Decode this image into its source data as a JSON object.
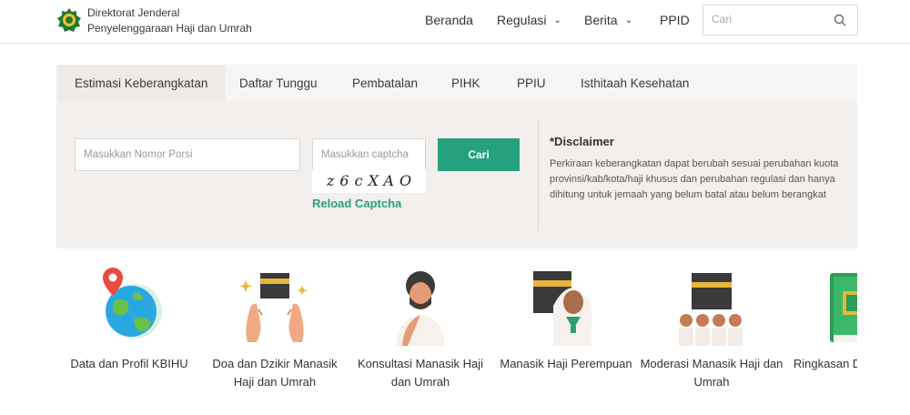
{
  "header": {
    "brand_line1": "Direktorat Jenderal",
    "brand_line2": "Penyelenggaraan Haji dan Umrah",
    "nav": [
      "Beranda",
      "Regulasi",
      "Berita",
      "PPID"
    ],
    "search_placeholder": "Cari"
  },
  "tabs": [
    "Estimasi Keberangkatan",
    "Daftar Tunggu",
    "Pembatalan",
    "PIHK",
    "PPIU",
    "Isthitaah Kesehatan"
  ],
  "form": {
    "porsi_placeholder": "Masukkan Nomor Porsi",
    "captcha_placeholder": "Masukkan captcha",
    "captcha_text": "z6cXAO",
    "submit_label": "Cari",
    "reload_label": "Reload Captcha"
  },
  "disclaimer": {
    "title": "*Disclaimer",
    "text": "Perkiraan keberangkatan dapat berubah sesuai perubahan kuota provinsi/kab/kota/haji khusus dan perubahan regulasi dan hanya dihitung untuk jemaah yang belum batal atau belum berangkat"
  },
  "services": [
    {
      "label": "Data dan Profil KBIHU",
      "icon": "globe-pin-icon"
    },
    {
      "label": "Doa dan Dzikir Manasik Haji dan Umrah",
      "icon": "praying-hands-icon"
    },
    {
      "label": "Konsultasi Manasik Haji dan Umrah",
      "icon": "pilgrim-man-icon"
    },
    {
      "label": "Manasik Haji Perempuan",
      "icon": "pilgrim-woman-icon"
    },
    {
      "label": "Moderasi Manasik Haji dan Umrah",
      "icon": "kaaba-group-icon"
    },
    {
      "label": "Ringkasan Doa Haji dan",
      "icon": "quran-book-icon"
    }
  ],
  "colors": {
    "accent": "#26a17e",
    "panel": "#f2efed"
  }
}
